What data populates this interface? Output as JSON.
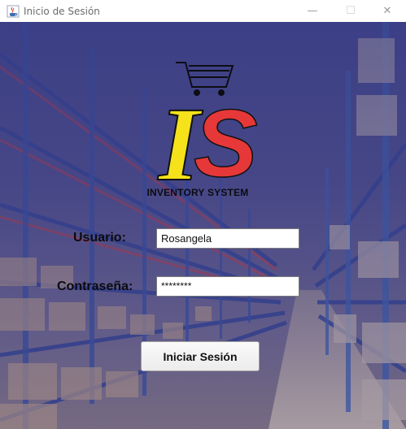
{
  "window": {
    "title": "Inicio de Sesión",
    "minimize_glyph": "—",
    "maximize_glyph": "☐",
    "close_glyph": "✕"
  },
  "logo": {
    "letters": "IS",
    "caption": "INVENTORY SYSTEM"
  },
  "form": {
    "username_label": "Usuario:",
    "username_value": "Rosangela",
    "password_label": "Contraseña:",
    "password_value": "********",
    "submit_label": "Iniciar Sesión"
  },
  "colors": {
    "logo_yellow": "#f5e21a",
    "logo_red": "#e63838",
    "overlay": "#3f4286"
  }
}
